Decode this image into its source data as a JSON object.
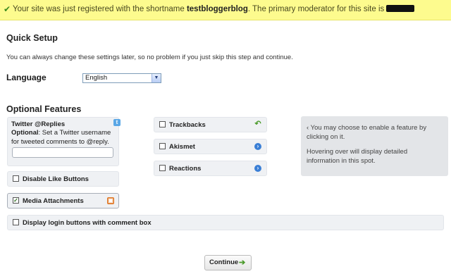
{
  "banner": {
    "prefix": "Your site was just registered with the shortname ",
    "shortname": "testbloggerblog",
    "suffix": ". The primary moderator for this site is "
  },
  "quick_setup": {
    "title": "Quick Setup",
    "note": "You can always change these settings later, so no problem if you just skip this step and continue."
  },
  "language": {
    "label": "Language",
    "selected": "English"
  },
  "optional": {
    "title": "Optional Features",
    "twitter": {
      "title": "Twitter @Replies",
      "desc_bold": "Optional",
      "desc_rest": ": Set a Twitter username for tweeted comments to @reply.",
      "input_value": ""
    },
    "disable_like": {
      "label": "Disable Like Buttons",
      "checked": false
    },
    "media": {
      "label": "Media Attachments",
      "checked": true
    },
    "trackbacks": {
      "label": "Trackbacks",
      "checked": false
    },
    "akismet": {
      "label": "Akismet",
      "checked": false
    },
    "reactions": {
      "label": "Reactions",
      "checked": false
    },
    "login_buttons": {
      "label": "Display login buttons with comment box",
      "checked": false
    }
  },
  "info": {
    "p1": "‹ You may choose to enable a feature by clicking on it.",
    "p2": "Hovering over will display detailed information in this spot."
  },
  "continue_label": "Continue",
  "colors": {
    "banner_bg": "#fdfb8e",
    "panel_bg": "#eff1f4",
    "check_green": "#3b8a1e"
  }
}
